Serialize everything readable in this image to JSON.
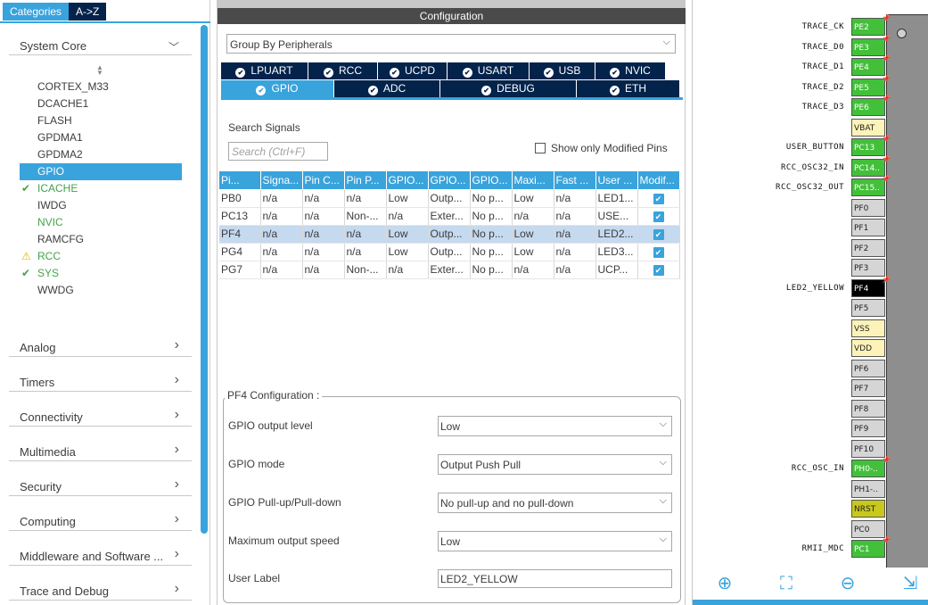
{
  "left": {
    "tabs": [
      "Categories",
      "A->Z"
    ],
    "system_core": "System Core",
    "items": [
      {
        "label": "CORTEX_M33",
        "status": ""
      },
      {
        "label": "DCACHE1",
        "status": ""
      },
      {
        "label": "FLASH",
        "status": ""
      },
      {
        "label": "GPDMA1",
        "status": ""
      },
      {
        "label": "GPDMA2",
        "status": ""
      },
      {
        "label": "GPIO",
        "status": "selected"
      },
      {
        "label": "ICACHE",
        "status": "ok"
      },
      {
        "label": "IWDG",
        "status": ""
      },
      {
        "label": "NVIC",
        "status": "green"
      },
      {
        "label": "RAMCFG",
        "status": ""
      },
      {
        "label": "RCC",
        "status": "warn"
      },
      {
        "label": "SYS",
        "status": "ok"
      },
      {
        "label": "WWDG",
        "status": ""
      }
    ],
    "categories": [
      "Analog",
      "Timers",
      "Connectivity",
      "Multimedia",
      "Security",
      "Computing",
      "Middleware and Software ...",
      "Trace and Debug"
    ]
  },
  "config": {
    "title": "Configuration",
    "group_by": "Group By Peripherals",
    "tabs_row1": [
      "LPUART",
      "RCC",
      "UCPD",
      "USART",
      "USB",
      "NVIC"
    ],
    "tabs_row2": [
      "GPIO",
      "ADC",
      "DEBUG",
      "ETH"
    ],
    "search_title": "Search Signals",
    "search_placeholder": "Search (Ctrl+F)",
    "show_modified": "Show only Modified Pins",
    "columns": [
      "Pi...",
      "Signa...",
      "Pin C...",
      "Pin P...",
      "GPIO...",
      "GPIO...",
      "GPIO...",
      "Maxi...",
      "Fast ...",
      "User ...",
      "Modif..."
    ],
    "rows": [
      [
        "PB0",
        "n/a",
        "n/a",
        "n/a",
        "Low",
        "Outp...",
        "No p...",
        "Low",
        "n/a",
        "LED1..."
      ],
      [
        "PC13",
        "n/a",
        "n/a",
        "Non-...",
        "n/a",
        "Exter...",
        "No p...",
        "n/a",
        "n/a",
        "USE..."
      ],
      [
        "PF4",
        "n/a",
        "n/a",
        "n/a",
        "Low",
        "Outp...",
        "No p...",
        "Low",
        "n/a",
        "LED2..."
      ],
      [
        "PG4",
        "n/a",
        "n/a",
        "n/a",
        "Low",
        "Outp...",
        "No p...",
        "Low",
        "n/a",
        "LED3..."
      ],
      [
        "PG7",
        "n/a",
        "n/a",
        "Non-...",
        "n/a",
        "Exter...",
        "No p...",
        "n/a",
        "n/a",
        "UCP..."
      ]
    ],
    "pf4": {
      "title": "PF4 Configuration :",
      "output_level_label": "GPIO output level",
      "output_level": "Low",
      "mode_label": "GPIO mode",
      "mode": "Output Push Pull",
      "pull_label": "GPIO Pull-up/Pull-down",
      "pull": "No pull-up and no pull-down",
      "speed_label": "Maximum output speed",
      "speed": "Low",
      "user_label_label": "User Label",
      "user_label": "LED2_YELLOW"
    }
  },
  "pins": [
    {
      "name": "PE2",
      "label": "TRACE_CK",
      "color": "green"
    },
    {
      "name": "PE3",
      "label": "TRACE_D0",
      "color": "green"
    },
    {
      "name": "PE4",
      "label": "TRACE_D1",
      "color": "green"
    },
    {
      "name": "PE5",
      "label": "TRACE_D2",
      "color": "green"
    },
    {
      "name": "PE6",
      "label": "TRACE_D3",
      "color": "green"
    },
    {
      "name": "VBAT",
      "label": "",
      "color": "yellow"
    },
    {
      "name": "PC13",
      "label": "USER_BUTTON",
      "color": "green"
    },
    {
      "name": "PC14..",
      "label": "RCC_OSC32_IN",
      "color": "green"
    },
    {
      "name": "PC15..",
      "label": "RCC_OSC32_OUT",
      "color": "green"
    },
    {
      "name": "PF0",
      "label": "",
      "color": "grey"
    },
    {
      "name": "PF1",
      "label": "",
      "color": "grey"
    },
    {
      "name": "PF2",
      "label": "",
      "color": "grey"
    },
    {
      "name": "PF3",
      "label": "",
      "color": "grey"
    },
    {
      "name": "PF4",
      "label": "LED2_YELLOW",
      "color": "black"
    },
    {
      "name": "PF5",
      "label": "",
      "color": "grey"
    },
    {
      "name": "VSS",
      "label": "",
      "color": "yellow"
    },
    {
      "name": "VDD",
      "label": "",
      "color": "yellow"
    },
    {
      "name": "PF6",
      "label": "",
      "color": "grey"
    },
    {
      "name": "PF7",
      "label": "",
      "color": "grey"
    },
    {
      "name": "PF8",
      "label": "",
      "color": "grey"
    },
    {
      "name": "PF9",
      "label": "",
      "color": "grey"
    },
    {
      "name": "PF10",
      "label": "",
      "color": "grey"
    },
    {
      "name": "PH0-..",
      "label": "RCC_OSC_IN",
      "color": "green"
    },
    {
      "name": "PH1-..",
      "label": "",
      "color": "grey"
    },
    {
      "name": "NRST",
      "label": "",
      "color": "olive"
    },
    {
      "name": "PC0",
      "label": "",
      "color": "grey"
    },
    {
      "name": "PC1",
      "label": "RMII_MDC",
      "color": "green"
    }
  ]
}
